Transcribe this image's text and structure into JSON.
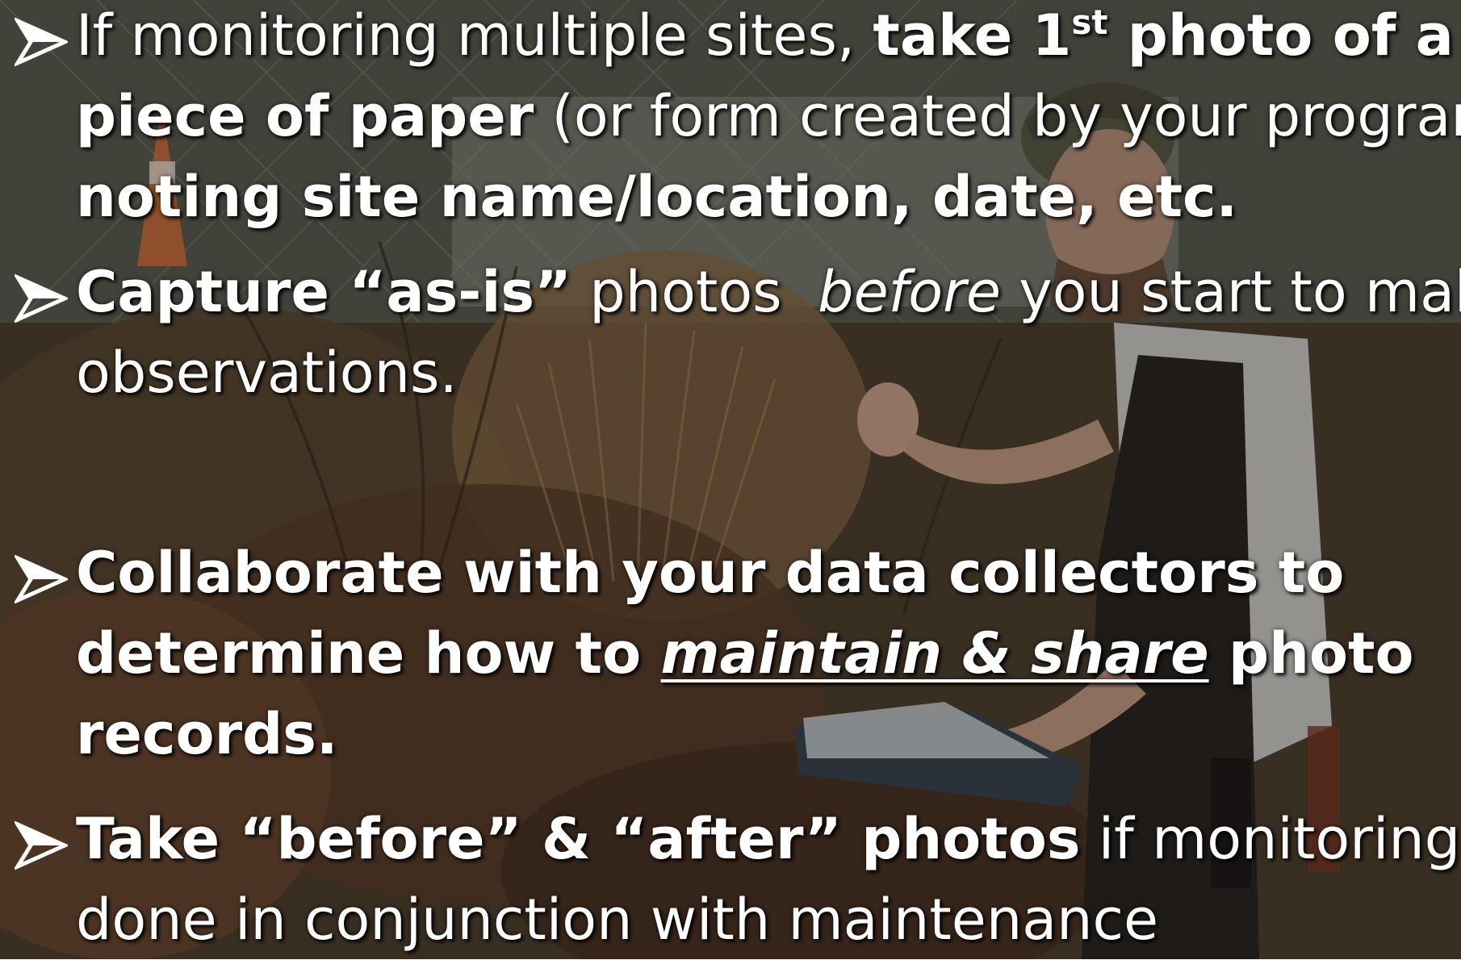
{
  "slide": {
    "bullets": [
      {
        "lines": [
          [
            {
              "text": "If monitoring multiple sites, ",
              "style": "normal"
            },
            {
              "text": "take 1",
              "style": "bold"
            },
            {
              "text": "st",
              "style": "sup"
            },
            {
              "text": " photo of a",
              "style": "bold"
            }
          ],
          [
            {
              "text": "piece of paper",
              "style": "bold"
            },
            {
              "text": " (or form created by your program)",
              "style": "normal"
            }
          ],
          [
            {
              "text": "noting site name/location, date, etc.",
              "style": "bold"
            }
          ]
        ]
      },
      {
        "lines": [
          [
            {
              "text": "Capture “as-is”",
              "style": "bold"
            },
            {
              "text": " photos  ",
              "style": "normal"
            },
            {
              "text": "before",
              "style": "italic"
            },
            {
              "text": " you start to make",
              "style": "normal"
            }
          ],
          [
            {
              "text": "observations.",
              "style": "normal"
            }
          ]
        ]
      },
      {
        "lines": [
          [
            {
              "text": "Collaborate with your data collectors to",
              "style": "bold"
            }
          ],
          [
            {
              "text": "determine how to ",
              "style": "bold"
            },
            {
              "text": "maintain & share",
              "style": "bold-italic-underline"
            },
            {
              "text": " photo",
              "style": "bold"
            }
          ],
          [
            {
              "text": "records.",
              "style": "bold"
            }
          ]
        ]
      },
      {
        "lines": [
          [
            {
              "text": "Take “before” & “after” photos",
              "style": "bold"
            },
            {
              "text": " if monitoring is",
              "style": "normal"
            }
          ],
          [
            {
              "text": "done in conjunction with maintenance",
              "style": "normal"
            }
          ]
        ]
      }
    ],
    "bullet_icon": "arrowhead-bullet-icon",
    "text_color": "#ffffff"
  }
}
